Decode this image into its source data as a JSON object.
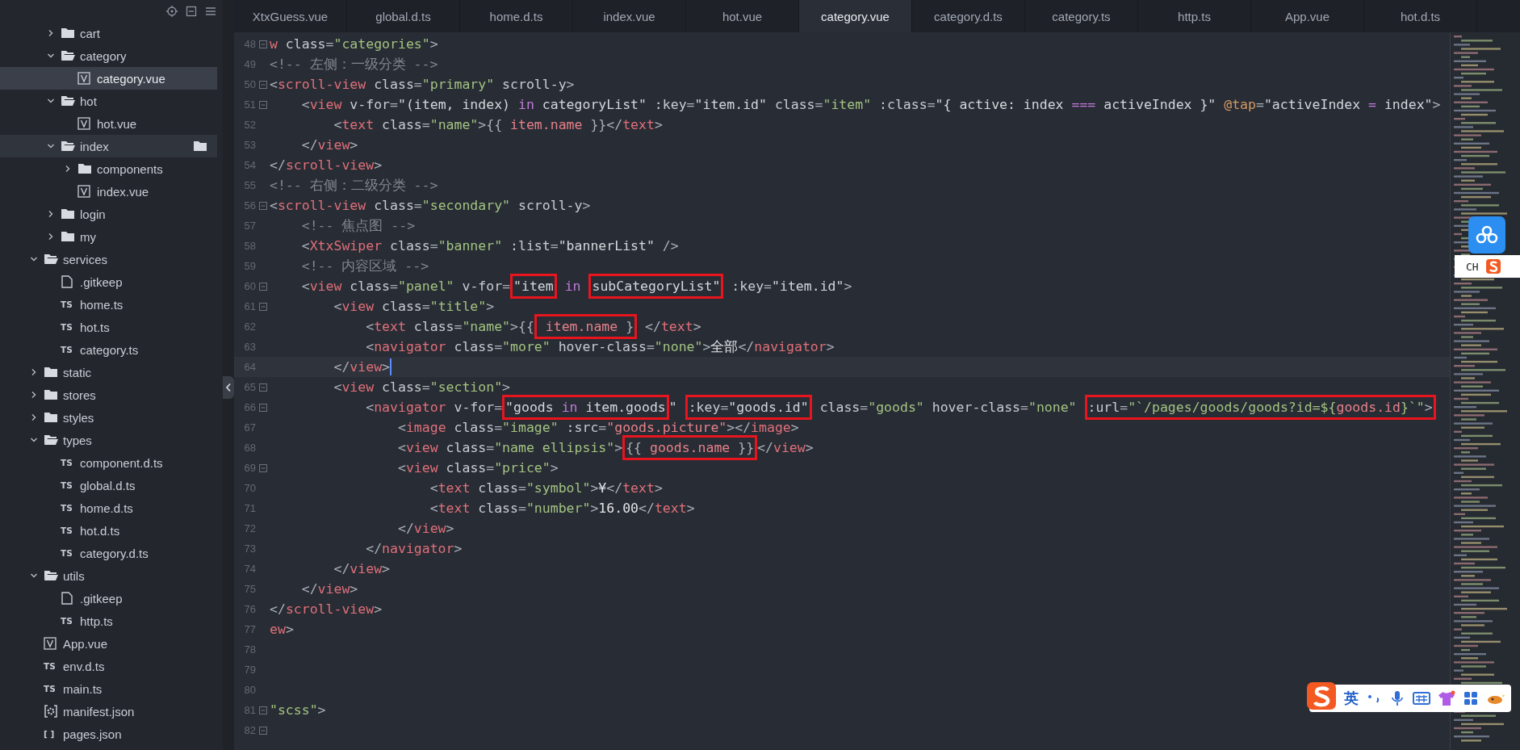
{
  "sidebar": {
    "nested_items": [
      {
        "label": "cart",
        "kind": "folder",
        "expanded": false,
        "selected": false,
        "hovered": false
      },
      {
        "label": "category",
        "kind": "folder",
        "expanded": true,
        "selected": false,
        "hovered": false,
        "children": [
          {
            "label": "category.vue",
            "kind": "vue",
            "selected": true,
            "hovered": false
          }
        ]
      },
      {
        "label": "hot",
        "kind": "folder",
        "expanded": true,
        "selected": false,
        "hovered": false,
        "children": [
          {
            "label": "hot.vue",
            "kind": "vue",
            "selected": false,
            "hovered": false
          }
        ]
      },
      {
        "label": "index",
        "kind": "folder",
        "expanded": true,
        "selected": false,
        "hovered": true,
        "children": [
          {
            "label": "components",
            "kind": "folder",
            "expanded": false,
            "selected": false,
            "hovered": false
          },
          {
            "label": "index.vue",
            "kind": "vue",
            "selected": false,
            "hovered": false
          }
        ]
      },
      {
        "label": "login",
        "kind": "folder",
        "expanded": false,
        "selected": false,
        "hovered": false
      },
      {
        "label": "my",
        "kind": "folder",
        "expanded": false,
        "selected": false,
        "hovered": false
      }
    ],
    "items": [
      {
        "label": "services",
        "kind": "folder",
        "expanded": true,
        "selected": false,
        "hovered": false,
        "children": [
          {
            "label": ".gitkeep",
            "kind": "file",
            "selected": false,
            "hovered": false
          },
          {
            "label": "home.ts",
            "kind": "ts",
            "badge": "TS",
            "selected": false,
            "hovered": false
          },
          {
            "label": "hot.ts",
            "kind": "ts",
            "badge": "TS",
            "selected": false,
            "hovered": false
          },
          {
            "label": "category.ts",
            "kind": "ts",
            "badge": "TS",
            "selected": false,
            "hovered": false
          }
        ]
      },
      {
        "label": "static",
        "kind": "folder",
        "expanded": false,
        "selected": false,
        "hovered": false
      },
      {
        "label": "stores",
        "kind": "folder",
        "expanded": false,
        "selected": false,
        "hovered": false
      },
      {
        "label": "styles",
        "kind": "folder",
        "expanded": false,
        "selected": false,
        "hovered": false
      },
      {
        "label": "types",
        "kind": "folder",
        "expanded": true,
        "selected": false,
        "hovered": false,
        "children": [
          {
            "label": "component.d.ts",
            "kind": "ts",
            "badge": "TS",
            "selected": false,
            "hovered": false
          },
          {
            "label": "global.d.ts",
            "kind": "ts",
            "badge": "TS",
            "selected": false,
            "hovered": false
          },
          {
            "label": "home.d.ts",
            "kind": "ts",
            "badge": "TS",
            "selected": false,
            "hovered": false
          },
          {
            "label": "hot.d.ts",
            "kind": "ts",
            "badge": "TS",
            "selected": false,
            "hovered": false
          },
          {
            "label": "category.d.ts",
            "kind": "ts",
            "badge": "TS",
            "selected": false,
            "hovered": false
          }
        ]
      },
      {
        "label": "utils",
        "kind": "folder",
        "expanded": true,
        "selected": false,
        "hovered": false,
        "children": [
          {
            "label": ".gitkeep",
            "kind": "file",
            "selected": false,
            "hovered": false
          },
          {
            "label": "http.ts",
            "kind": "ts",
            "badge": "TS",
            "selected": false,
            "hovered": false
          }
        ]
      },
      {
        "label": "App.vue",
        "kind": "vue",
        "selected": false,
        "hovered": false
      },
      {
        "label": "env.d.ts",
        "kind": "ts",
        "badge": "TS",
        "selected": false,
        "hovered": false
      },
      {
        "label": "main.ts",
        "kind": "ts",
        "badge": "TS",
        "selected": false,
        "hovered": false
      },
      {
        "label": "manifest.json",
        "kind": "config",
        "selected": false,
        "hovered": false
      },
      {
        "label": "pages.json",
        "kind": "json",
        "badge": "[ ]",
        "selected": false,
        "hovered": false
      }
    ]
  },
  "tabs": [
    {
      "label": "XtxGuess.vue",
      "selected": false
    },
    {
      "label": "global.d.ts",
      "selected": false
    },
    {
      "label": "home.d.ts",
      "selected": false
    },
    {
      "label": "index.vue",
      "selected": false
    },
    {
      "label": "hot.vue",
      "selected": false
    },
    {
      "label": "category.vue",
      "selected": true
    },
    {
      "label": "category.d.ts",
      "selected": false
    },
    {
      "label": "category.ts",
      "selected": false
    },
    {
      "label": "http.ts",
      "selected": false
    },
    {
      "label": "App.vue",
      "selected": false
    },
    {
      "label": "hot.d.ts",
      "selected": false
    }
  ],
  "editor": {
    "lines": [
      {
        "number": "48",
        "fold": true,
        "current": false,
        "tokens": [
          {
            "kind": "tag",
            "text": "w"
          },
          {
            "kind": "attr",
            "text": " class"
          },
          {
            "kind": "p",
            "text": "="
          },
          {
            "kind": "str",
            "text": "\"categories\""
          },
          {
            "kind": "p",
            "text": ">"
          }
        ]
      },
      {
        "number": "49",
        "fold": false,
        "current": false,
        "tokens": [
          {
            "kind": "cm",
            "text": "<!-- 左侧：一级分类 -->"
          }
        ]
      },
      {
        "number": "50",
        "fold": true,
        "current": false,
        "tokens": [
          {
            "kind": "p",
            "text": "<"
          },
          {
            "kind": "tag",
            "text": "scroll-view"
          },
          {
            "kind": "attr",
            "text": " class"
          },
          {
            "kind": "p",
            "text": "="
          },
          {
            "kind": "str",
            "text": "\"primary\""
          },
          {
            "kind": "attr",
            "text": " scroll-y"
          },
          {
            "kind": "p",
            "text": ">"
          }
        ]
      },
      {
        "number": "51",
        "fold": true,
        "current": false,
        "tokens": [
          {
            "kind": "p",
            "text": "    <"
          },
          {
            "kind": "tag",
            "text": "view"
          },
          {
            "kind": "attr",
            "text": " v-for"
          },
          {
            "kind": "p",
            "text": "="
          },
          {
            "kind": "expr",
            "text": "\"(item, index) "
          },
          {
            "kind": "kw",
            "text": "in"
          },
          {
            "kind": "expr",
            "text": " categoryList\""
          },
          {
            "kind": "attr",
            "text": " :key"
          },
          {
            "kind": "p",
            "text": "="
          },
          {
            "kind": "expr",
            "text": "\"item.id\""
          },
          {
            "kind": "attr",
            "text": " class"
          },
          {
            "kind": "p",
            "text": "="
          },
          {
            "kind": "str",
            "text": "\"item\""
          },
          {
            "kind": "attr",
            "text": " :class"
          },
          {
            "kind": "p",
            "text": "="
          },
          {
            "kind": "expr",
            "text": "\"{ active: index "
          },
          {
            "kind": "kw",
            "text": "==="
          },
          {
            "kind": "expr",
            "text": " activeIndex }\""
          },
          {
            "kind": "ev",
            "text": " @tap"
          },
          {
            "kind": "p",
            "text": "="
          },
          {
            "kind": "expr",
            "text": "\"activeIndex "
          },
          {
            "kind": "kw",
            "text": "="
          },
          {
            "kind": "expr",
            "text": " index\""
          },
          {
            "kind": "p",
            "text": ">"
          }
        ]
      },
      {
        "number": "52",
        "fold": false,
        "current": false,
        "tokens": [
          {
            "kind": "p",
            "text": "        <"
          },
          {
            "kind": "tag",
            "text": "text"
          },
          {
            "kind": "attr",
            "text": " class"
          },
          {
            "kind": "p",
            "text": "="
          },
          {
            "kind": "str",
            "text": "\"name\""
          },
          {
            "kind": "p",
            "text": ">{{ "
          },
          {
            "kind": "var",
            "text": "item.name"
          },
          {
            "kind": "p",
            "text": " }}</"
          },
          {
            "kind": "tag",
            "text": "text"
          },
          {
            "kind": "p",
            "text": ">"
          }
        ]
      },
      {
        "number": "53",
        "fold": false,
        "current": false,
        "tokens": [
          {
            "kind": "p",
            "text": "    </"
          },
          {
            "kind": "tag",
            "text": "view"
          },
          {
            "kind": "p",
            "text": ">"
          }
        ]
      },
      {
        "number": "54",
        "fold": false,
        "current": false,
        "tokens": [
          {
            "kind": "p",
            "text": "</"
          },
          {
            "kind": "tag",
            "text": "scroll-view"
          },
          {
            "kind": "p",
            "text": ">"
          }
        ]
      },
      {
        "number": "55",
        "fold": false,
        "current": false,
        "tokens": [
          {
            "kind": "cm",
            "text": "<!-- 右侧：二级分类 -->"
          }
        ]
      },
      {
        "number": "56",
        "fold": true,
        "current": false,
        "tokens": [
          {
            "kind": "p",
            "text": "<"
          },
          {
            "kind": "tag",
            "text": "scroll-view"
          },
          {
            "kind": "attr",
            "text": " class"
          },
          {
            "kind": "p",
            "text": "="
          },
          {
            "kind": "str",
            "text": "\"secondary\""
          },
          {
            "kind": "attr",
            "text": " scroll-y"
          },
          {
            "kind": "p",
            "text": ">"
          }
        ]
      },
      {
        "number": "57",
        "fold": false,
        "current": false,
        "tokens": [
          {
            "kind": "cm",
            "text": "    <!-- 焦点图 -->"
          }
        ]
      },
      {
        "number": "58",
        "fold": false,
        "current": false,
        "tokens": [
          {
            "kind": "p",
            "text": "    <"
          },
          {
            "kind": "tag",
            "text": "XtxSwiper"
          },
          {
            "kind": "attr",
            "text": " class"
          },
          {
            "kind": "p",
            "text": "="
          },
          {
            "kind": "str",
            "text": "\"banner\""
          },
          {
            "kind": "attr",
            "text": " :list"
          },
          {
            "kind": "p",
            "text": "="
          },
          {
            "kind": "expr",
            "text": "\"bannerList\""
          },
          {
            "kind": "p",
            "text": " />"
          }
        ]
      },
      {
        "number": "59",
        "fold": false,
        "current": false,
        "tokens": [
          {
            "kind": "cm",
            "text": "    <!-- 内容区域 -->"
          }
        ]
      },
      {
        "number": "60",
        "fold": true,
        "current": false,
        "tokens": [
          {
            "kind": "p",
            "text": "    <"
          },
          {
            "kind": "tag",
            "text": "view"
          },
          {
            "kind": "attr",
            "text": " class"
          },
          {
            "kind": "p",
            "text": "="
          },
          {
            "kind": "str",
            "text": "\"panel\""
          },
          {
            "kind": "attr",
            "text": " v-for"
          },
          {
            "kind": "p",
            "text": "="
          },
          {
            "kind": "box",
            "children": [
              {
                "kind": "expr",
                "text": "\"item"
              }
            ]
          },
          {
            "kind": "kw",
            "text": " in "
          },
          {
            "kind": "box",
            "children": [
              {
                "kind": "expr",
                "text": "subCategoryList\""
              }
            ]
          },
          {
            "kind": "attr",
            "text": " :key"
          },
          {
            "kind": "p",
            "text": "="
          },
          {
            "kind": "expr",
            "text": "\"item.id\""
          },
          {
            "kind": "p",
            "text": ">"
          }
        ]
      },
      {
        "number": "61",
        "fold": true,
        "current": false,
        "tokens": [
          {
            "kind": "p",
            "text": "        <"
          },
          {
            "kind": "tag",
            "text": "view"
          },
          {
            "kind": "attr",
            "text": " class"
          },
          {
            "kind": "p",
            "text": "="
          },
          {
            "kind": "str",
            "text": "\"title\""
          },
          {
            "kind": "p",
            "text": ">"
          }
        ]
      },
      {
        "number": "62",
        "fold": false,
        "current": false,
        "tokens": [
          {
            "kind": "p",
            "text": "            <"
          },
          {
            "kind": "tag",
            "text": "text"
          },
          {
            "kind": "attr",
            "text": " class"
          },
          {
            "kind": "p",
            "text": "="
          },
          {
            "kind": "str",
            "text": "\"name\""
          },
          {
            "kind": "p",
            "text": ">{{"
          },
          {
            "kind": "box",
            "children": [
              {
                "kind": "var",
                "text": " item.name "
              },
              {
                "kind": "p",
                "text": "}"
              }
            ]
          },
          {
            "kind": "p",
            "text": " </"
          },
          {
            "kind": "tag",
            "text": "text"
          },
          {
            "kind": "p",
            "text": ">"
          }
        ]
      },
      {
        "number": "63",
        "fold": false,
        "current": false,
        "tokens": [
          {
            "kind": "p",
            "text": "            <"
          },
          {
            "kind": "tag",
            "text": "navigator"
          },
          {
            "kind": "attr",
            "text": " class"
          },
          {
            "kind": "p",
            "text": "="
          },
          {
            "kind": "str",
            "text": "\"more\""
          },
          {
            "kind": "attr",
            "text": " hover-class"
          },
          {
            "kind": "p",
            "text": "="
          },
          {
            "kind": "str",
            "text": "\"none\""
          },
          {
            "kind": "p",
            "text": ">"
          },
          {
            "kind": "txt",
            "text": "全部"
          },
          {
            "kind": "p",
            "text": "</"
          },
          {
            "kind": "tag",
            "text": "navigator"
          },
          {
            "kind": "p",
            "text": ">"
          }
        ]
      },
      {
        "number": "64",
        "fold": false,
        "current": true,
        "tokens": [
          {
            "kind": "p",
            "text": "        </"
          },
          {
            "kind": "tag",
            "text": "view"
          },
          {
            "kind": "p",
            "text": ">"
          }
        ]
      },
      {
        "number": "65",
        "fold": true,
        "current": false,
        "tokens": [
          {
            "kind": "p",
            "text": "        <"
          },
          {
            "kind": "tag",
            "text": "view"
          },
          {
            "kind": "attr",
            "text": " class"
          },
          {
            "kind": "p",
            "text": "="
          },
          {
            "kind": "str",
            "text": "\"section\""
          },
          {
            "kind": "p",
            "text": ">"
          }
        ]
      },
      {
        "number": "66",
        "fold": true,
        "current": false,
        "tokens": [
          {
            "kind": "p",
            "text": "            <"
          },
          {
            "kind": "tag",
            "text": "navigator"
          },
          {
            "kind": "attr",
            "text": " v-for"
          },
          {
            "kind": "p",
            "text": "="
          },
          {
            "kind": "box",
            "children": [
              {
                "kind": "expr",
                "text": "\"goods "
              },
              {
                "kind": "kw",
                "text": "in"
              },
              {
                "kind": "expr",
                "text": " item.goods"
              }
            ]
          },
          {
            "kind": "expr",
            "text": "\" "
          },
          {
            "kind": "box",
            "children": [
              {
                "kind": "attr",
                "text": ":key"
              },
              {
                "kind": "p",
                "text": "="
              },
              {
                "kind": "expr",
                "text": "\"goods.id\""
              }
            ]
          },
          {
            "kind": "attr",
            "text": " class"
          },
          {
            "kind": "p",
            "text": "="
          },
          {
            "kind": "str",
            "text": "\"goods\""
          },
          {
            "kind": "attr",
            "text": " hover-class"
          },
          {
            "kind": "p",
            "text": "="
          },
          {
            "kind": "str",
            "text": "\"none\" "
          },
          {
            "kind": "box",
            "children": [
              {
                "kind": "attr",
                "text": ":url"
              },
              {
                "kind": "p",
                "text": "="
              },
              {
                "kind": "str",
                "text": "\"`/pages/goods/goods?id=${"
              },
              {
                "kind": "var",
                "text": "goods.id"
              },
              {
                "kind": "str",
                "text": "}`\""
              },
              {
                "kind": "p",
                "text": ">"
              }
            ]
          }
        ]
      },
      {
        "number": "67",
        "fold": false,
        "current": false,
        "tokens": [
          {
            "kind": "p",
            "text": "                <"
          },
          {
            "kind": "tag",
            "text": "image"
          },
          {
            "kind": "attr",
            "text": " class"
          },
          {
            "kind": "p",
            "text": "="
          },
          {
            "kind": "str",
            "text": "\"image\""
          },
          {
            "kind": "attr",
            "text": " :src"
          },
          {
            "kind": "p",
            "text": "="
          },
          {
            "kind": "var",
            "text": "\"goods.picture\""
          },
          {
            "kind": "p",
            "text": "></"
          },
          {
            "kind": "tag",
            "text": "image"
          },
          {
            "kind": "p",
            "text": ">"
          }
        ]
      },
      {
        "number": "68",
        "fold": false,
        "current": false,
        "tokens": [
          {
            "kind": "p",
            "text": "                <"
          },
          {
            "kind": "tag",
            "text": "view"
          },
          {
            "kind": "attr",
            "text": " class"
          },
          {
            "kind": "p",
            "text": "="
          },
          {
            "kind": "str",
            "text": "\"name ellipsis\""
          },
          {
            "kind": "p",
            "text": ">"
          },
          {
            "kind": "box",
            "children": [
              {
                "kind": "p",
                "text": "{{ "
              },
              {
                "kind": "var",
                "text": "goods.name"
              },
              {
                "kind": "p",
                "text": " }}"
              }
            ]
          },
          {
            "kind": "p",
            "text": "</"
          },
          {
            "kind": "tag",
            "text": "view"
          },
          {
            "kind": "p",
            "text": ">"
          }
        ]
      },
      {
        "number": "69",
        "fold": true,
        "current": false,
        "tokens": [
          {
            "kind": "p",
            "text": "                <"
          },
          {
            "kind": "tag",
            "text": "view"
          },
          {
            "kind": "attr",
            "text": " class"
          },
          {
            "kind": "p",
            "text": "="
          },
          {
            "kind": "str",
            "text": "\"price\""
          },
          {
            "kind": "p",
            "text": ">"
          }
        ]
      },
      {
        "number": "70",
        "fold": false,
        "current": false,
        "tokens": [
          {
            "kind": "p",
            "text": "                    <"
          },
          {
            "kind": "tag",
            "text": "text"
          },
          {
            "kind": "attr",
            "text": " class"
          },
          {
            "kind": "p",
            "text": "="
          },
          {
            "kind": "str",
            "text": "\"symbol\""
          },
          {
            "kind": "p",
            "text": ">"
          },
          {
            "kind": "txt",
            "text": "¥"
          },
          {
            "kind": "p",
            "text": "</"
          },
          {
            "kind": "tag",
            "text": "text"
          },
          {
            "kind": "p",
            "text": ">"
          }
        ]
      },
      {
        "number": "71",
        "fold": false,
        "current": false,
        "tokens": [
          {
            "kind": "p",
            "text": "                    <"
          },
          {
            "kind": "tag",
            "text": "text"
          },
          {
            "kind": "attr",
            "text": " class"
          },
          {
            "kind": "p",
            "text": "="
          },
          {
            "kind": "str",
            "text": "\"number\""
          },
          {
            "kind": "p",
            "text": ">"
          },
          {
            "kind": "txt",
            "text": "16.00"
          },
          {
            "kind": "p",
            "text": "</"
          },
          {
            "kind": "tag",
            "text": "text"
          },
          {
            "kind": "p",
            "text": ">"
          }
        ]
      },
      {
        "number": "72",
        "fold": false,
        "current": false,
        "tokens": [
          {
            "kind": "p",
            "text": "                </"
          },
          {
            "kind": "tag",
            "text": "view"
          },
          {
            "kind": "p",
            "text": ">"
          }
        ]
      },
      {
        "number": "73",
        "fold": false,
        "current": false,
        "tokens": [
          {
            "kind": "p",
            "text": "            </"
          },
          {
            "kind": "tag",
            "text": "navigator"
          },
          {
            "kind": "p",
            "text": ">"
          }
        ]
      },
      {
        "number": "74",
        "fold": false,
        "current": false,
        "tokens": [
          {
            "kind": "p",
            "text": "        </"
          },
          {
            "kind": "tag",
            "text": "view"
          },
          {
            "kind": "p",
            "text": ">"
          }
        ]
      },
      {
        "number": "75",
        "fold": false,
        "current": false,
        "tokens": [
          {
            "kind": "p",
            "text": "    </"
          },
          {
            "kind": "tag",
            "text": "view"
          },
          {
            "kind": "p",
            "text": ">"
          }
        ]
      },
      {
        "number": "76",
        "fold": false,
        "current": false,
        "tokens": [
          {
            "kind": "p",
            "text": "</"
          },
          {
            "kind": "tag",
            "text": "scroll-view"
          },
          {
            "kind": "p",
            "text": ">"
          }
        ]
      },
      {
        "number": "77",
        "fold": false,
        "current": false,
        "tokens": [
          {
            "kind": "tag",
            "text": "ew"
          },
          {
            "kind": "p",
            "text": ">"
          }
        ]
      },
      {
        "number": "78",
        "fold": false,
        "current": false
      },
      {
        "number": "79",
        "fold": false,
        "current": false
      },
      {
        "number": "80",
        "fold": false,
        "current": false
      },
      {
        "number": "81",
        "fold": true,
        "current": false,
        "tokens": [
          {
            "kind": "str",
            "text": "\"scss\""
          },
          {
            "kind": "p",
            "text": ">"
          }
        ]
      },
      {
        "number": "82",
        "fold": true,
        "current": false
      }
    ]
  },
  "ime_status": {
    "language": "CH"
  },
  "ime_toolbar": {
    "language": "英"
  }
}
